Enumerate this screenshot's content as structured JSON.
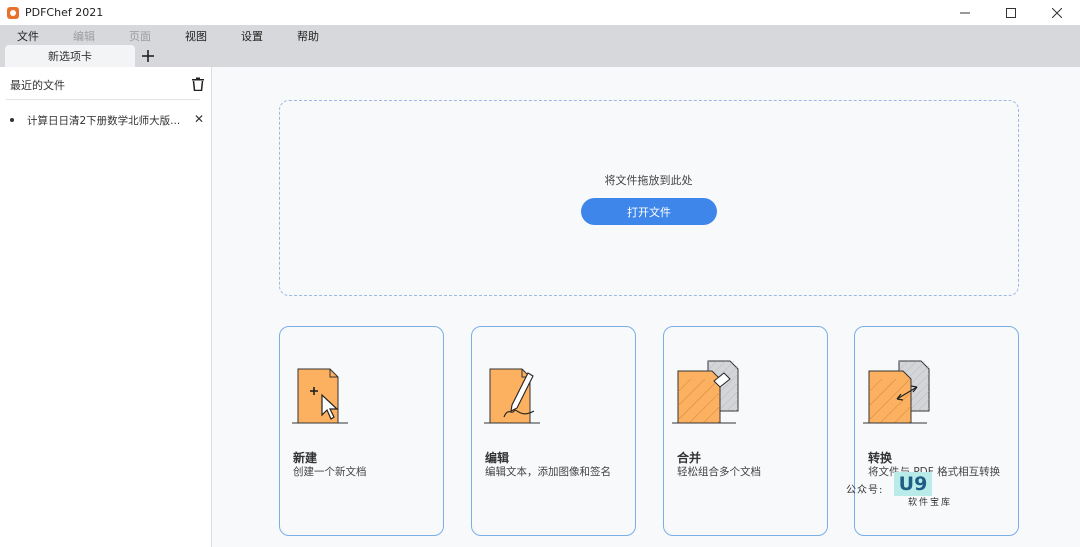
{
  "window": {
    "title": "PDFChef 2021",
    "controls": [
      "minimize-icon",
      "maximize-icon",
      "close-icon"
    ]
  },
  "menu": {
    "items": [
      {
        "label": "文件",
        "enabled": true
      },
      {
        "label": "编辑",
        "enabled": false
      },
      {
        "label": "页面",
        "enabled": false
      },
      {
        "label": "视图",
        "enabled": true
      },
      {
        "label": "设置",
        "enabled": true
      },
      {
        "label": "帮助",
        "enabled": true
      }
    ]
  },
  "tabs": {
    "items": [
      {
        "label": "新选项卡",
        "active": true
      }
    ],
    "add_icon": "plus-icon"
  },
  "sidebar": {
    "header": "最近的文件",
    "clear_icon": "trash-icon",
    "recent_files": [
      {
        "label": "计算日日清2下册数学北师大版..."
      }
    ]
  },
  "dropzone": {
    "text": "将文件拖放到此处",
    "button_label": "打开文件"
  },
  "cards": [
    {
      "title": "新建",
      "desc": "创建一个新文档",
      "icon": "new-document-icon"
    },
    {
      "title": "编辑",
      "desc": "编辑文本，添加图像和签名",
      "icon": "edit-document-icon"
    },
    {
      "title": "合并",
      "desc": "轻松组合多个文档",
      "icon": "merge-documents-icon"
    },
    {
      "title": "转换",
      "desc": "将文件与 PDF 格式相互转换",
      "icon": "convert-document-icon"
    }
  ],
  "watermark": {
    "label": "公众号:",
    "logo": "U9",
    "sub": "软件宝库"
  },
  "colors": {
    "accent": "#3f86ea",
    "card_border": "#7aaee8",
    "doc_orange": "#fbb160",
    "app_icon": "#e8722c"
  }
}
